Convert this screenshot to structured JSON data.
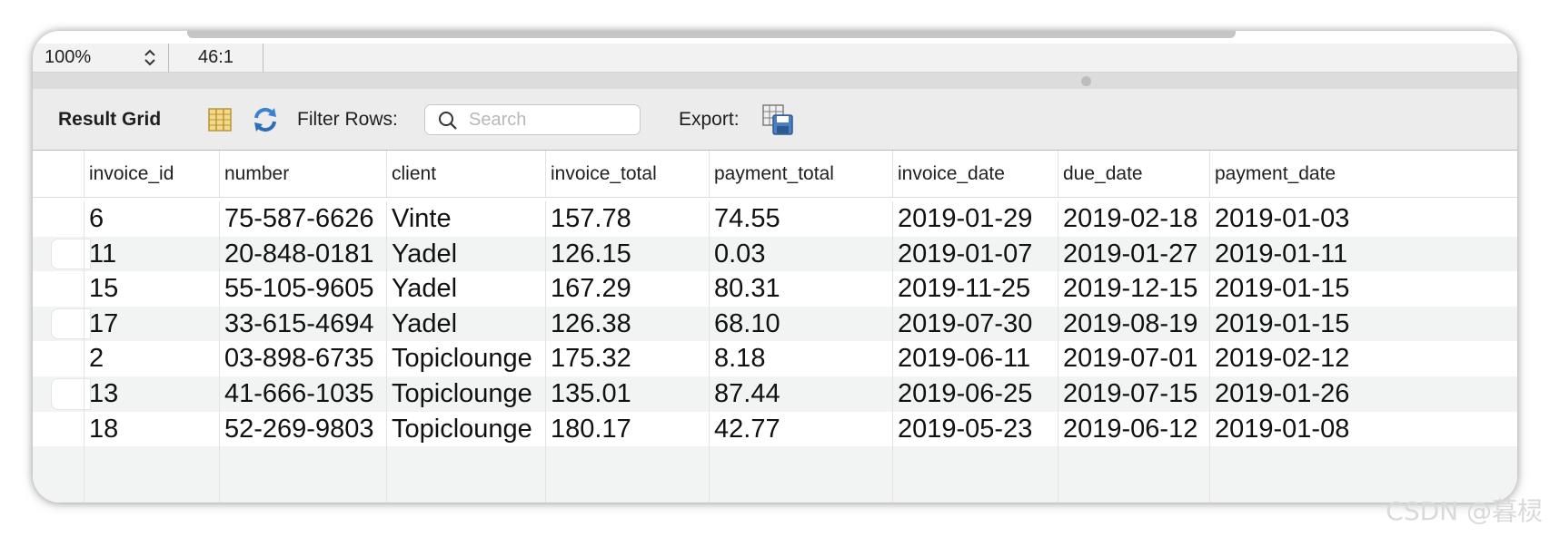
{
  "status_bar": {
    "zoom": "100%",
    "cursor_position": "46:1"
  },
  "toolbar": {
    "title": "Result Grid",
    "filter_label": "Filter Rows:",
    "search_placeholder": "Search",
    "export_label": "Export:"
  },
  "grid": {
    "columns": [
      "invoice_id",
      "number",
      "client",
      "invoice_total",
      "payment_total",
      "invoice_date",
      "due_date",
      "payment_date"
    ],
    "rows": [
      [
        "6",
        "75-587-6626",
        "Vinte",
        "157.78",
        "74.55",
        "2019-01-29",
        "2019-02-18",
        "2019-01-03"
      ],
      [
        "11",
        "20-848-0181",
        "Yadel",
        "126.15",
        "0.03",
        "2019-01-07",
        "2019-01-27",
        "2019-01-11"
      ],
      [
        "15",
        "55-105-9605",
        "Yadel",
        "167.29",
        "80.31",
        "2019-11-25",
        "2019-12-15",
        "2019-01-15"
      ],
      [
        "17",
        "33-615-4694",
        "Yadel",
        "126.38",
        "68.10",
        "2019-07-30",
        "2019-08-19",
        "2019-01-15"
      ],
      [
        "2",
        "03-898-6735",
        "Topiclounge",
        "175.32",
        "8.18",
        "2019-06-11",
        "2019-07-01",
        "2019-02-12"
      ],
      [
        "13",
        "41-666-1035",
        "Topiclounge",
        "135.01",
        "87.44",
        "2019-06-25",
        "2019-07-15",
        "2019-01-26"
      ],
      [
        "18",
        "52-269-9803",
        "Topiclounge",
        "180.17",
        "42.77",
        "2019-05-23",
        "2019-06-12",
        "2019-01-08"
      ]
    ]
  },
  "watermark": "CSDN @暮棂",
  "colors": {
    "toolbar_bg": "#ececec",
    "alt_row_bg": "#f2f4f4",
    "refresh_icon_blue": "#3b82d6"
  },
  "icons": [
    "stepper-icon",
    "grid-layout-icon",
    "refresh-icon",
    "search-icon",
    "export-icon"
  ]
}
